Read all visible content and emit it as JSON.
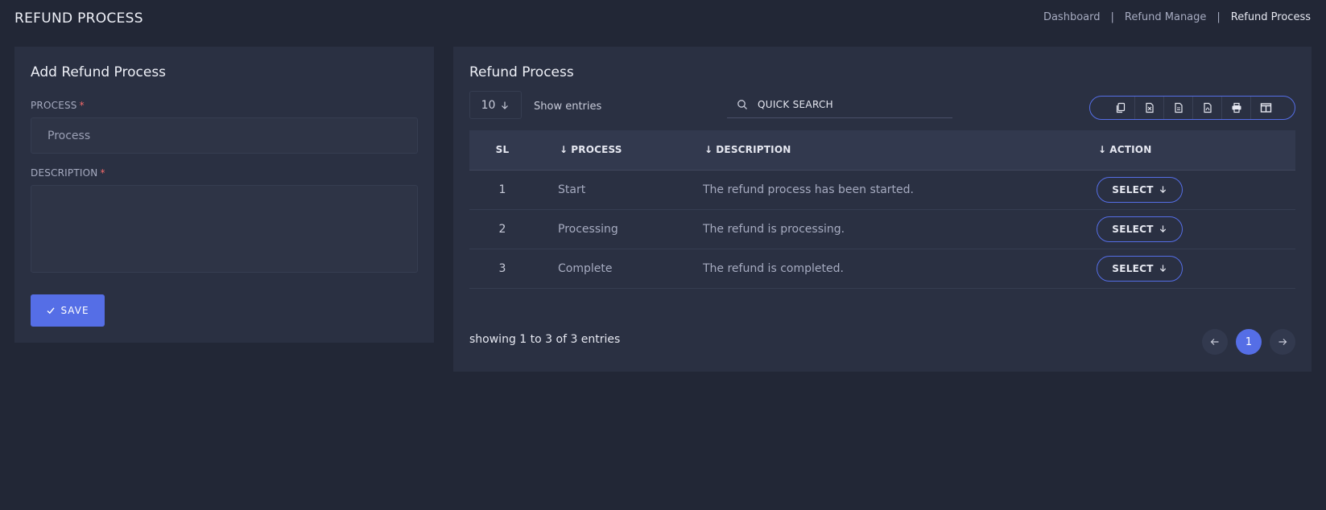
{
  "header": {
    "title": "REFUND PROCESS",
    "breadcrumb": [
      "Dashboard",
      "Refund Manage",
      "Refund Process"
    ],
    "breadcrumb_separator": "|"
  },
  "form": {
    "title": "Add Refund Process",
    "process_label": "PROCESS",
    "process_placeholder": "Process",
    "process_value": "",
    "description_label": "DESCRIPTION",
    "description_value": "",
    "required_mark": "*",
    "save_label": "SAVE",
    "save_icon": "check-icon"
  },
  "list": {
    "title": "Refund Process",
    "entries_value": "10",
    "show_entries_label": "Show entries",
    "search_placeholder": "QUICK SEARCH",
    "export_buttons": [
      "copy-icon",
      "excel-icon",
      "csv-icon",
      "pdf-icon",
      "print-icon",
      "columns-icon"
    ],
    "columns": [
      "SL",
      "PROCESS",
      "DESCRIPTION",
      "ACTION"
    ],
    "rows": [
      {
        "sl": "1",
        "process": "Start",
        "description": "The refund process has been started.",
        "action": "SELECT"
      },
      {
        "sl": "2",
        "process": "Processing",
        "description": "The refund is processing.",
        "action": "SELECT"
      },
      {
        "sl": "3",
        "process": "Complete",
        "description": "The refund is completed.",
        "action": "SELECT"
      }
    ],
    "showing_text": "showing 1 to 3 of 3 entries",
    "current_page": "1"
  },
  "colors": {
    "background": "#222736",
    "card": "#2a3042",
    "accent": "#556ee6",
    "required": "#f46a6a"
  }
}
